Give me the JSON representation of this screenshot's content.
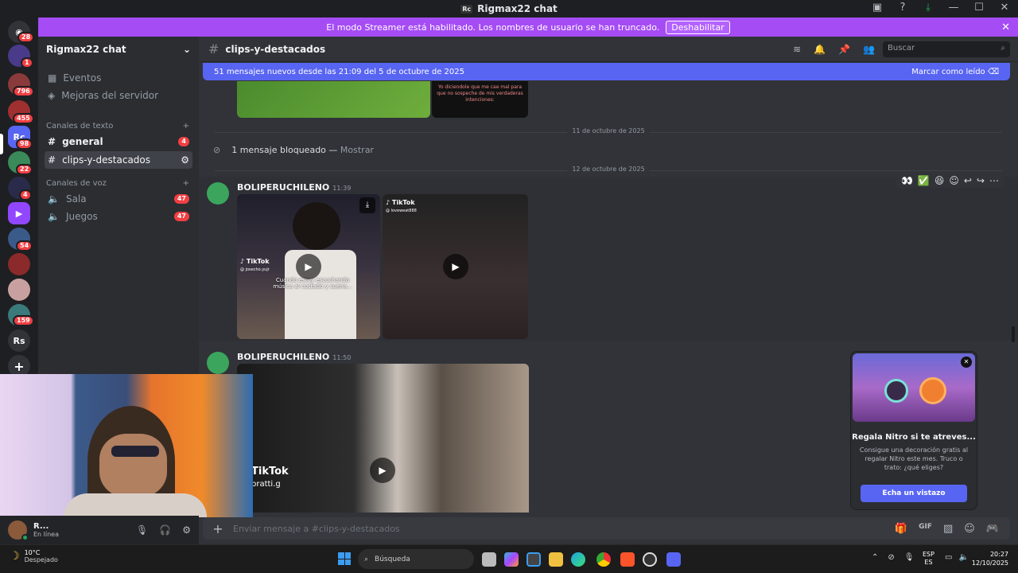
{
  "window": {
    "title": "Rigmax22 chat",
    "logo_text": "Rc"
  },
  "banner": {
    "text": "El modo Streamer está habilitado. Los nombres de usuario se han truncado.",
    "button": "Deshabilitar"
  },
  "servers": [
    {
      "label": "",
      "badge": "28"
    },
    {
      "label": "",
      "badge": "1"
    },
    {
      "label": "",
      "badge": "796"
    },
    {
      "label": "",
      "badge": "455"
    },
    {
      "label": "Rc",
      "badge": "98"
    },
    {
      "label": "",
      "badge": "22"
    },
    {
      "label": "",
      "badge": "4"
    },
    {
      "label": "",
      "badge": ""
    },
    {
      "label": "",
      "badge": "54"
    },
    {
      "label": "",
      "badge": ""
    },
    {
      "label": "",
      "badge": ""
    },
    {
      "label": "",
      "badge": "159"
    },
    {
      "label": "Rs",
      "badge": ""
    }
  ],
  "sidebar": {
    "server_name": "Rigmax22 chat",
    "events": "Eventos",
    "boosts": "Mejoras del servidor",
    "text_category": "Canales de texto",
    "voice_category": "Canales de voz",
    "text_channels": [
      {
        "name": "general",
        "badge": "4"
      },
      {
        "name": "clips-y-destacados",
        "badge": ""
      }
    ],
    "voice_channels": [
      {
        "name": "Sala",
        "badge": "47"
      },
      {
        "name": "Juegos",
        "badge": "47"
      }
    ]
  },
  "channel": {
    "name": "clips-y-destacados",
    "search_placeholder": "Buscar",
    "new_messages": "51 mensajes nuevos desde las 21:09 del 5 de octubre de 2025",
    "mark_read": "Marcar como leído"
  },
  "messages": {
    "divider1": "11 de octubre de 2025",
    "blocked": "1 mensaje bloqueado",
    "blocked_action": "Mostrar",
    "divider2": "12 de octubre de 2025",
    "top_overlay_text": "Yo diciendole que me cae mal para que no sospeche de mis verdaderas intenciones:",
    "msg1": {
      "author": "BOLIPERUCHILENO",
      "time": "11:39",
      "caption": "Cuando estoy escuchando música al costado y suena...",
      "tiktok_user1": "@ josecho.yujr",
      "tiktok_user2": "@ loveweat888"
    },
    "msg2": {
      "author": "BOLIPERUCHILENO",
      "time": "11:50",
      "tiktok": "TikTok",
      "tiktok_user": "bratti.g"
    }
  },
  "composer": {
    "placeholder": "Enviar mensaje a #clips-y-destacados"
  },
  "user": {
    "name": "R...",
    "status": "En línea"
  },
  "popup": {
    "title": "Regala Nitro si te atreves...",
    "body": "Consigue una decoración gratis al regalar Nitro este mes. Truco o trato: ¿qué eliges?",
    "button": "Echa un vistazo"
  },
  "taskbar": {
    "temp": "10°C",
    "weather": "Despejado",
    "search": "Búsqueda",
    "lang1": "ESP",
    "lang2": "ES",
    "time": "20:27",
    "date": "12/10/2025"
  },
  "colors": {
    "accent": "#5865f2",
    "banner": "#a54cf5",
    "danger": "#f23f43"
  }
}
